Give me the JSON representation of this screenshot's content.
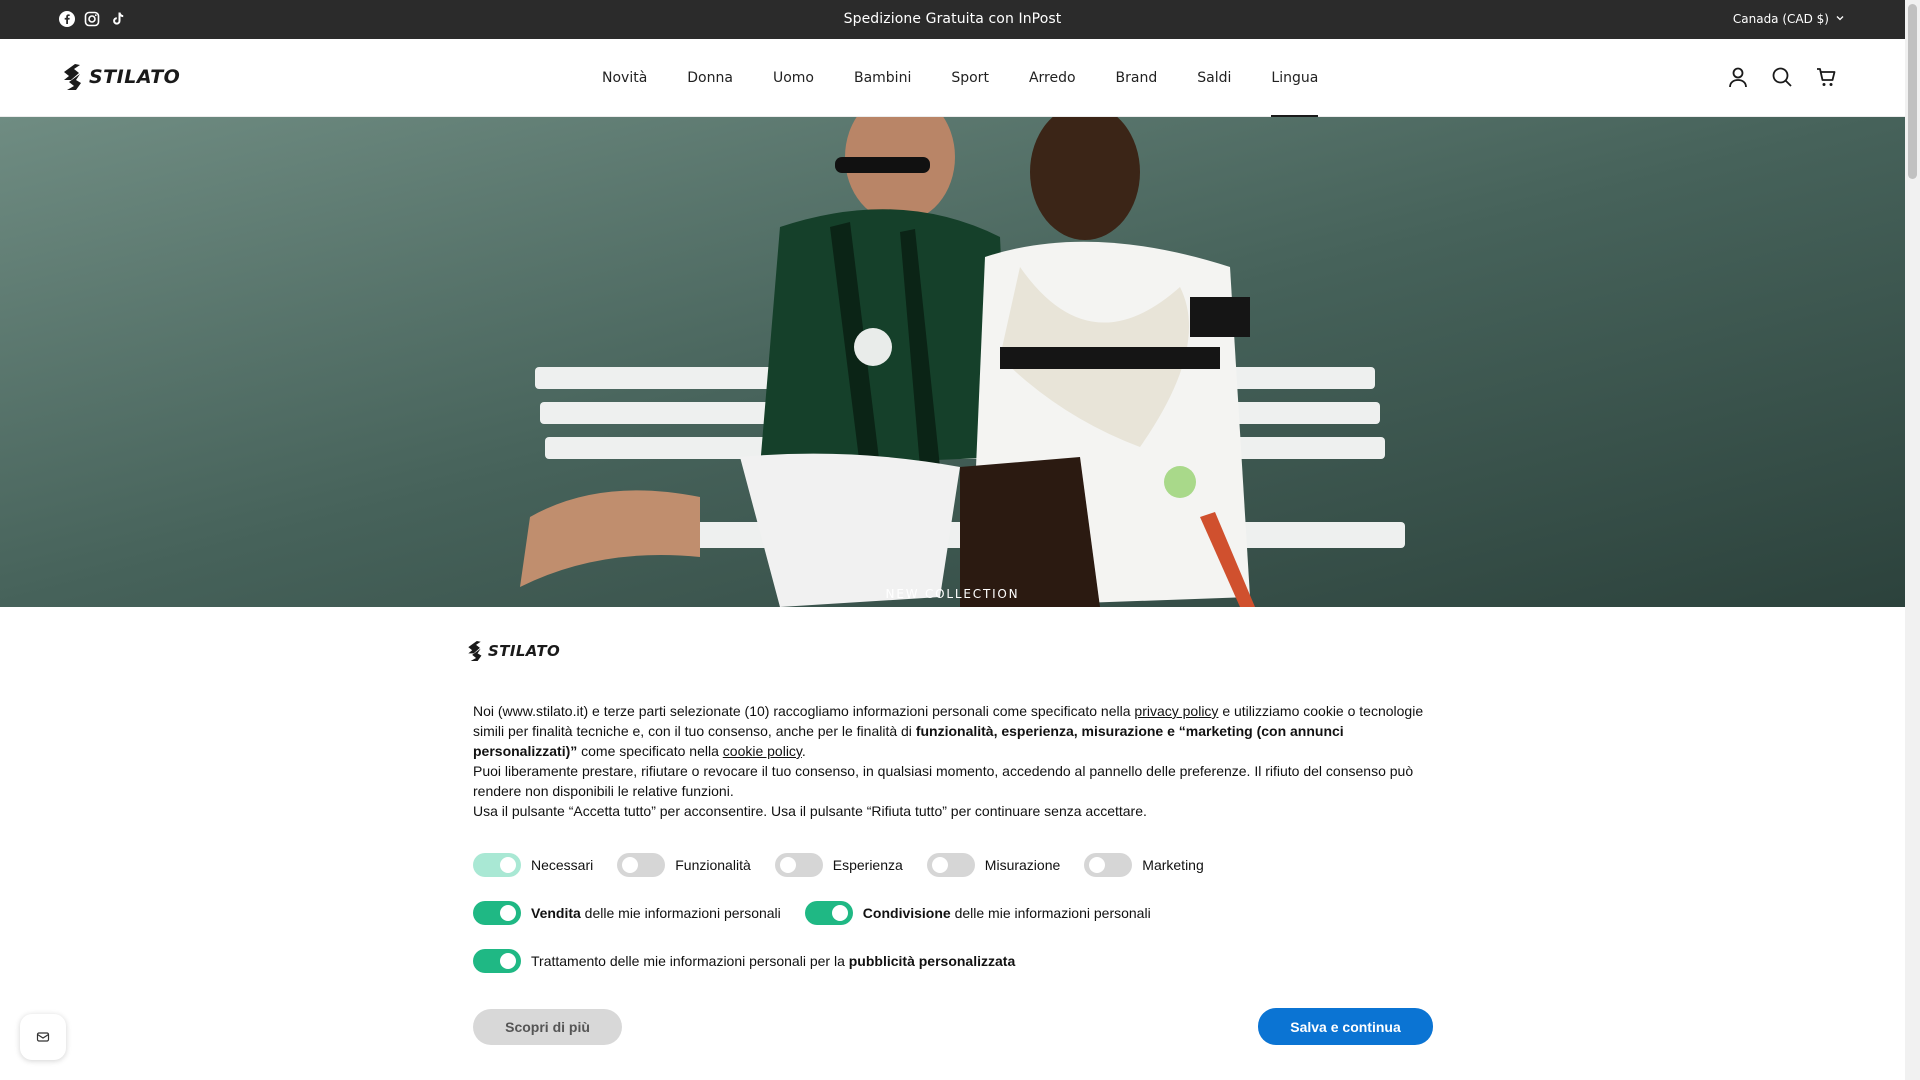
{
  "announcement": {
    "social_icons": [
      "facebook-icon",
      "instagram-icon",
      "tiktok-icon"
    ],
    "promo": "Spedizione Gratuita con InPost",
    "currency": "Canada (CAD $)"
  },
  "header": {
    "logo_text": "STILATO",
    "nav": [
      "Novità",
      "Donna",
      "Uomo",
      "Bambini",
      "Sport",
      "Arredo",
      "Brand",
      "Saldi",
      "Lingua"
    ],
    "active_nav": "Lingua",
    "icons": [
      "account-icon",
      "search-icon",
      "cart-icon"
    ]
  },
  "hero": {
    "label": "NEW COLLECTION"
  },
  "consent": {
    "logo_text": "STILATO",
    "p1_a": "Noi (www.stilato.it) e terze parti selezionate (10) raccogliamo informazioni personali come specificato nella ",
    "p1_link1": "privacy policy",
    "p1_b": " e utilizziamo cookie o tecnologie simili per finalità tecniche e, con il tuo consenso, anche per le finalità di ",
    "p1_bold": "funzionalità, esperienza, misurazione e “marketing (con annunci personalizzati)”",
    "p1_c": " come specificato nella ",
    "p1_link2": "cookie policy",
    "p1_d": ".",
    "p2": "Puoi liberamente prestare, rifiutare o revocare il tuo consenso, in qualsiasi momento, accedendo al pannello delle preferenze. Il rifiuto del consenso può rendere non disponibili le relative funzioni.",
    "p3": "Usa il pulsante “Accetta tutto” per acconsentire. Usa il pulsante “Rifiuta tutto” per continuare senza accettare.",
    "toggles": [
      {
        "label": "Necessari",
        "state": "on-disabled"
      },
      {
        "label": "Funzionalità",
        "state": "off"
      },
      {
        "label": "Esperienza",
        "state": "off"
      },
      {
        "label": "Misurazione",
        "state": "off"
      },
      {
        "label": "Marketing",
        "state": "off"
      }
    ],
    "sale_bold": "Vendita",
    "sale_rest": " delle mie informazioni personali",
    "share_bold": "Condivisione",
    "share_rest": " delle mie informazioni personali",
    "ads_rest": "Trattamento delle mie informazioni personali per la ",
    "ads_bold": "pubblicità personalizzata",
    "btn_more": "Scopri di più",
    "btn_save": "Salva e continua"
  },
  "colors": {
    "topbar": "#2b2b2b",
    "toggle_on": "#1fb884",
    "primary_button": "#0b74d3"
  }
}
